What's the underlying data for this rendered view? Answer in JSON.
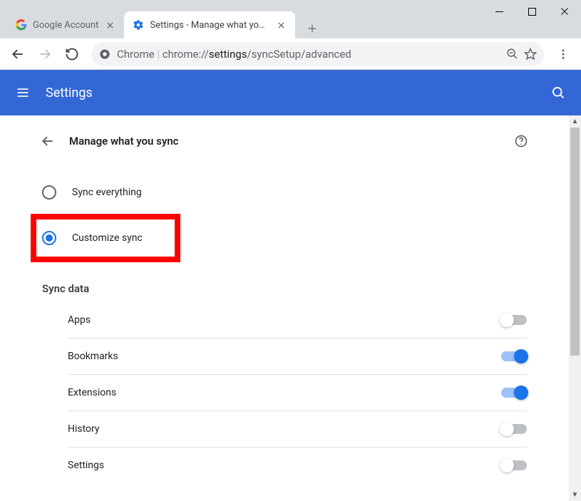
{
  "window": {
    "tabs": [
      {
        "title": "Google Account",
        "favicon": "google-logo",
        "active": false
      },
      {
        "title": "Settings - Manage what you sync",
        "favicon": "settings-gear",
        "active": true
      }
    ]
  },
  "toolbar": {
    "url_prefix": "Chrome",
    "url_host": "chrome://",
    "url_bold": "settings",
    "url_rest": "/syncSetup/advanced"
  },
  "header": {
    "title": "Settings"
  },
  "page": {
    "title": "Manage what you sync",
    "radios": [
      {
        "id": "sync-everything",
        "label": "Sync everything",
        "selected": false
      },
      {
        "id": "customize-sync",
        "label": "Customize sync",
        "selected": true
      }
    ],
    "section_title": "Sync data",
    "sync_items": [
      {
        "label": "Apps",
        "on": false
      },
      {
        "label": "Bookmarks",
        "on": true
      },
      {
        "label": "Extensions",
        "on": true
      },
      {
        "label": "History",
        "on": false
      },
      {
        "label": "Settings",
        "on": false
      }
    ]
  }
}
